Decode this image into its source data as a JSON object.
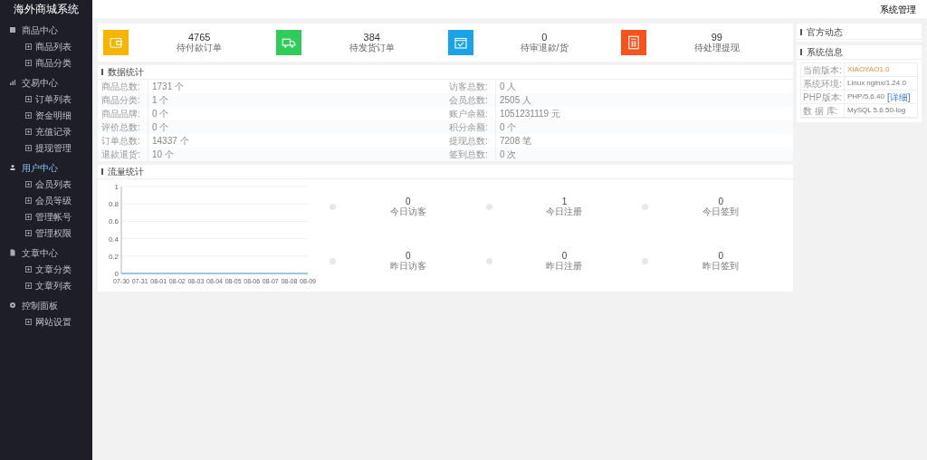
{
  "sidebar": {
    "title": "海外商城系统",
    "groups": [
      {
        "label": "商品中心",
        "selected": false,
        "children": [
          {
            "label": "商品列表"
          },
          {
            "label": "商品分类"
          }
        ]
      },
      {
        "label": "交易中心",
        "selected": false,
        "children": [
          {
            "label": "订单列表"
          },
          {
            "label": "资金明细"
          },
          {
            "label": "充值记录"
          },
          {
            "label": "提现管理"
          }
        ]
      },
      {
        "label": "用户中心",
        "selected": true,
        "children": [
          {
            "label": "会员列表"
          },
          {
            "label": "会员等级"
          },
          {
            "label": "管理帐号"
          },
          {
            "label": "管理权限"
          }
        ]
      },
      {
        "label": "文章中心",
        "selected": false,
        "children": [
          {
            "label": "文章分类"
          },
          {
            "label": "文章列表"
          }
        ]
      },
      {
        "label": "控制面板",
        "selected": false,
        "children": [
          {
            "label": "网站设置"
          }
        ]
      }
    ]
  },
  "header": {
    "link": "系统管理"
  },
  "cards": [
    {
      "value": "4765",
      "label": "待付款订单",
      "color": "#f7b500"
    },
    {
      "value": "384",
      "label": "待发货订单",
      "color": "#2fcc59"
    },
    {
      "value": "0",
      "label": "待审退款/货",
      "color": "#1aa3e8"
    },
    {
      "value": "99",
      "label": "待处理提现",
      "color": "#f5541e"
    }
  ],
  "data_stats": {
    "title": "数据统计",
    "rows": [
      [
        {
          "label": "商品总数:",
          "value": "1731 个"
        },
        {
          "label": "访客总数:",
          "value": "0 人"
        }
      ],
      [
        {
          "label": "商品分类:",
          "value": "1 个"
        },
        {
          "label": "会员总数:",
          "value": "2505 人"
        }
      ],
      [
        {
          "label": "商品品牌:",
          "value": "0 个"
        },
        {
          "label": "账户余额:",
          "value": "1051231119 元"
        }
      ],
      [
        {
          "label": "评价总数:",
          "value": "0 个"
        },
        {
          "label": "积分余额:",
          "value": "0 个"
        }
      ],
      [
        {
          "label": "订单总数:",
          "value": "14337 个"
        },
        {
          "label": "提现总数:",
          "value": "7208 笔"
        }
      ],
      [
        {
          "label": "退款退货:",
          "value": "10 个"
        },
        {
          "label": "签到总数:",
          "value": "0 次"
        }
      ]
    ]
  },
  "traffic": {
    "title": "流量统计",
    "chart_data": {
      "type": "line",
      "categories": [
        "07-30",
        "07-31",
        "08-01",
        "08-02",
        "08-03",
        "08-04",
        "08-05",
        "08-06",
        "08-07",
        "08-08",
        "08-09"
      ],
      "grid": true,
      "series": [
        {
          "color": "#5bb3e6",
          "values": [
            0,
            0,
            0,
            0,
            0,
            0,
            0,
            0,
            0,
            0,
            0
          ]
        }
      ],
      "ylim": [
        0,
        1
      ],
      "yticks": [
        0,
        0.2,
        0.4,
        0.6,
        0.8,
        1
      ]
    },
    "stats": [
      {
        "value": "0",
        "label": "今日访客"
      },
      {
        "value": "1",
        "label": "今日注册"
      },
      {
        "value": "0",
        "label": "今日签到"
      },
      {
        "value": "0",
        "label": "昨日访客"
      },
      {
        "value": "0",
        "label": "昨日注册"
      },
      {
        "value": "0",
        "label": "昨日签到"
      }
    ]
  },
  "news": {
    "title": "官方动态"
  },
  "system": {
    "title": "系统信息",
    "rows": [
      {
        "label": "当前版本:",
        "value": "XIAOYAO1.0",
        "kind": "highlight"
      },
      {
        "label": "系统环境:",
        "value": "Linux nginx/1.24.0",
        "kind": "plain"
      },
      {
        "label": "PHP版本:",
        "value": "PHP/5.6.40",
        "kind": "plain",
        "link": "[详细]"
      },
      {
        "label": "数 据 库:",
        "value": "MySQL 5.6.50-log",
        "kind": "plain"
      }
    ]
  }
}
